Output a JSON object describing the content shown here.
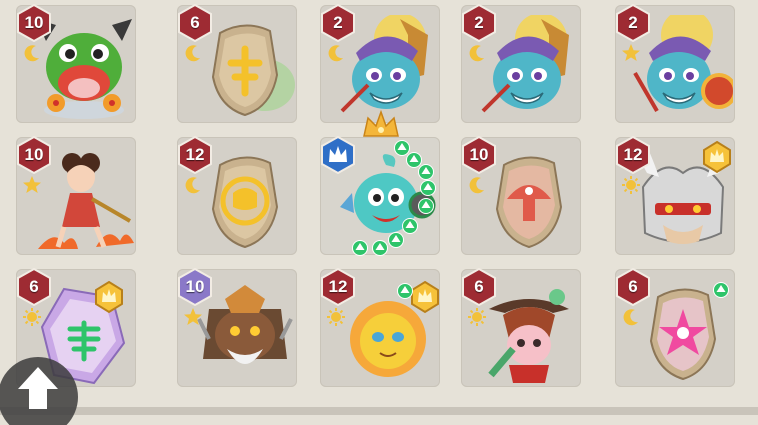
{
  "colors": {
    "badge_red": "#9e2b33",
    "badge_purple": "#8a78c8",
    "badge_blue": "#2f6fc7",
    "upgrade_green": "#2ec46a",
    "moon": "#f2c13a",
    "crown": "#f4b63a"
  },
  "cards": [
    {
      "level": "10",
      "badge": "red",
      "element": "moon-icon",
      "art": "green-dragon"
    },
    {
      "level": "6",
      "badge": "red",
      "element": "moon-icon",
      "art": "rune-stone-cross"
    },
    {
      "level": "2",
      "badge": "red",
      "element": "moon-icon",
      "art": "blue-knight-harp"
    },
    {
      "level": "2",
      "badge": "red",
      "element": "moon-icon",
      "art": "blue-knight-harp"
    },
    {
      "level": "2",
      "badge": "red",
      "element": "star-icon",
      "art": "blue-knight-harp"
    },
    {
      "level": "10",
      "badge": "red",
      "element": "star-icon",
      "art": "warrior-girl"
    },
    {
      "level": "12",
      "badge": "red",
      "element": "moon-icon",
      "art": "rune-stone-fist"
    },
    {
      "level": "",
      "badge": "blue-crown",
      "element": "",
      "art": "teal-fish-spirit"
    },
    {
      "level": "10",
      "badge": "red",
      "element": "moon-icon",
      "art": "rune-stone-mushroom"
    },
    {
      "level": "12",
      "badge": "red",
      "element": "sun-icon",
      "art": "armored-beast"
    },
    {
      "level": "6",
      "badge": "red",
      "element": "sun-icon",
      "art": "crystal-shard"
    },
    {
      "level": "10",
      "badge": "purple",
      "element": "star-icon",
      "art": "chained-golem"
    },
    {
      "level": "12",
      "badge": "red",
      "element": "sun-icon",
      "art": "sun-lion"
    },
    {
      "level": "6",
      "badge": "red",
      "element": "sun-icon",
      "art": "witch-guitar"
    },
    {
      "level": "6",
      "badge": "red",
      "element": "moon-icon",
      "art": "rune-stone-star"
    }
  ]
}
